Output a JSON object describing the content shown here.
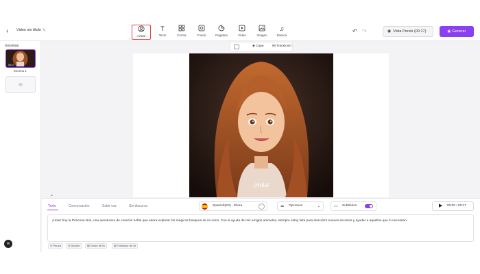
{
  "header": {
    "project_title": "Video sin título",
    "tools": [
      {
        "label": "Avatar",
        "icon": "avatar-icon"
      },
      {
        "label": "Texto",
        "icon": "text-icon"
      },
      {
        "label": "Forma",
        "icon": "shape-icon"
      },
      {
        "label": "Fondo",
        "icon": "background-icon"
      },
      {
        "label": "Pegatina",
        "icon": "sticker-icon"
      },
      {
        "label": "Vídeo",
        "icon": "video-icon"
      },
      {
        "label": "Imagen",
        "icon": "image-icon"
      },
      {
        "label": "Música",
        "icon": "music-icon"
      }
    ],
    "active_tool": "Avatar",
    "preview_label": "Vista Previo (00:17)",
    "generate_label": "Generar"
  },
  "scenes": {
    "title": "Escenas",
    "items": [
      {
        "label": "Escena 1",
        "duration": "00:17"
      }
    ]
  },
  "canvas_toolbar": {
    "layer_label": "Capa",
    "transition_label": "Transición"
  },
  "canvas": {
    "subtitle": "¡Hola!"
  },
  "bottom": {
    "tabs": [
      "Texto",
      "Conversación",
      "Subir voz",
      "Sin discurso"
    ],
    "active_tab": "Texto",
    "voice": "Spanish(ES) - Elvira",
    "options_label": "Opciones",
    "subtitles_label": "Subtítulos",
    "subtitles_on": true,
    "time": "00:00 / 00:17",
    "script": "¡Hola! Soy la Princesa Nos, una aventurera de corazón noble que adora explorar los mágicos bosques de mi reino. Con la ayuda de mis amigos animales, siempre estoy lista para descubrir nuevos secretos y ayudar a aquellos que lo necesitan.",
    "chips": [
      "Pausa",
      "Dicción",
      "Guion de IA",
      "Traductor de IA"
    ]
  },
  "colors": {
    "accent": "#8a3ff1",
    "active_outline": "#e0434a"
  }
}
